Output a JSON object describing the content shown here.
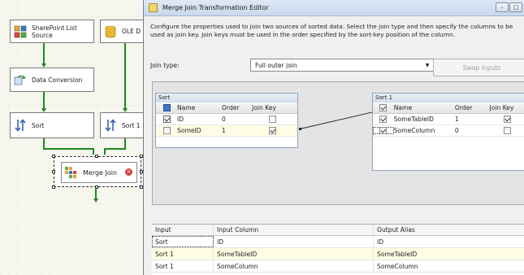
{
  "designer": {
    "components": {
      "sharepoint": {
        "label": "SharePoint List Source"
      },
      "ole": {
        "label": "OLE D"
      },
      "conversion": {
        "label": "Data Conversion"
      },
      "sort_left": {
        "label": "Sort"
      },
      "sort_right": {
        "label": "Sort 1"
      },
      "merge_join": {
        "label": "Merge Join"
      }
    },
    "colors": {
      "path_green": "#1c8a1c",
      "error_icon": "#d9403a"
    }
  },
  "dialog": {
    "title": "Merge Join Transformation Editor",
    "description": "Configure the properties used to join two sources of sorted data. Select the join type and then specify the columns to be used as join key. Join keys must be used in the order specified by the sort-key position of the column.",
    "join_type_label": "Join type:",
    "join_type_value": "Full outer join",
    "swap_inputs_label": "Swap Inputs",
    "left_table": {
      "title": "Sort",
      "columns": [
        "Name",
        "Order",
        "Join Key"
      ],
      "rows": [
        {
          "name": "ID",
          "order": "0",
          "checked": true,
          "join_key": false
        },
        {
          "name": "SomeID",
          "order": "1",
          "checked": false,
          "join_key": true
        }
      ]
    },
    "right_table": {
      "title": "Sort 1",
      "columns": [
        "Name",
        "Order",
        "Join Key"
      ],
      "rows": [
        {
          "name": "SomeTableID",
          "order": "1",
          "checked": true,
          "join_key": true
        },
        {
          "name": "SomeColumn",
          "order": "0",
          "checked": true,
          "join_key": false
        }
      ]
    },
    "output_grid": {
      "headers": [
        "Input",
        "Input Column",
        "Output Alias"
      ],
      "rows": [
        {
          "input": "Sort",
          "column": "ID",
          "alias": "ID"
        },
        {
          "input": "Sort 1",
          "column": "SomeTableID",
          "alias": "SomeTableID"
        },
        {
          "input": "Sort 1",
          "column": "SomeColumn",
          "alias": "SomeColumn"
        }
      ]
    }
  }
}
